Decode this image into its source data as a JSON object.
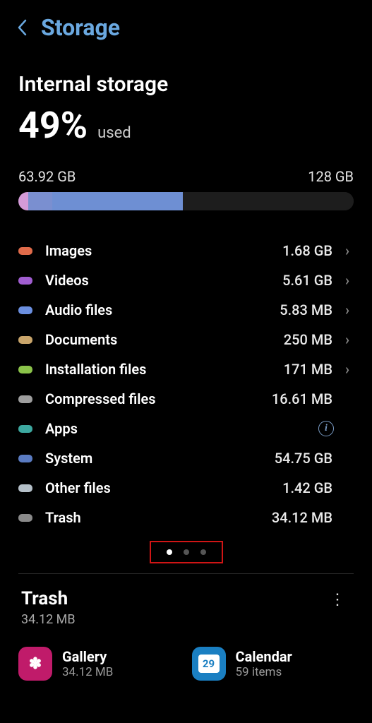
{
  "header": {
    "title": "Storage"
  },
  "section": {
    "title": "Internal storage",
    "percent": "49%",
    "used_label": "used",
    "used": "63.92 GB",
    "total": "128 GB"
  },
  "bar_segments": [
    {
      "color": "#d49bd8",
      "pct": 3
    },
    {
      "color": "#7a8fd0",
      "pct": 7
    },
    {
      "color": "#6e8fd3",
      "pct": 39
    },
    {
      "color": "#1d1d1d",
      "pct": 51
    }
  ],
  "categories": [
    {
      "label": "Images",
      "size": "1.68 GB",
      "color": "#e06b4a",
      "chevron": true
    },
    {
      "label": "Videos",
      "size": "5.61 GB",
      "color": "#a05dd0",
      "chevron": true
    },
    {
      "label": "Audio files",
      "size": "5.83 MB",
      "color": "#6b8fe0",
      "chevron": true
    },
    {
      "label": "Documents",
      "size": "250 MB",
      "color": "#c9a56b",
      "chevron": true
    },
    {
      "label": "Installation files",
      "size": "171 MB",
      "color": "#8bc34a",
      "chevron": true
    },
    {
      "label": "Compressed files",
      "size": "16.61 MB",
      "color": "#9e9e9e",
      "chevron": false
    },
    {
      "label": "Apps",
      "size": "",
      "color": "#3da8a0",
      "chevron": false,
      "info": true
    },
    {
      "label": "System",
      "size": "54.75 GB",
      "color": "#5a7bc2",
      "chevron": false
    },
    {
      "label": "Other files",
      "size": "1.42 GB",
      "color": "#b5c0c9",
      "chevron": false
    },
    {
      "label": "Trash",
      "size": "34.12 MB",
      "color": "#8a8a8a",
      "chevron": false
    }
  ],
  "pagination": {
    "count": 3,
    "active": 0
  },
  "trash": {
    "title": "Trash",
    "subtitle": "34.12 MB",
    "apps": [
      {
        "name": "Gallery",
        "sub": "34.12 MB",
        "icon": "gallery",
        "glyph": "✽",
        "cal": ""
      },
      {
        "name": "Calendar",
        "sub": "59 items",
        "icon": "calendar",
        "glyph": "",
        "cal": "29"
      }
    ]
  }
}
